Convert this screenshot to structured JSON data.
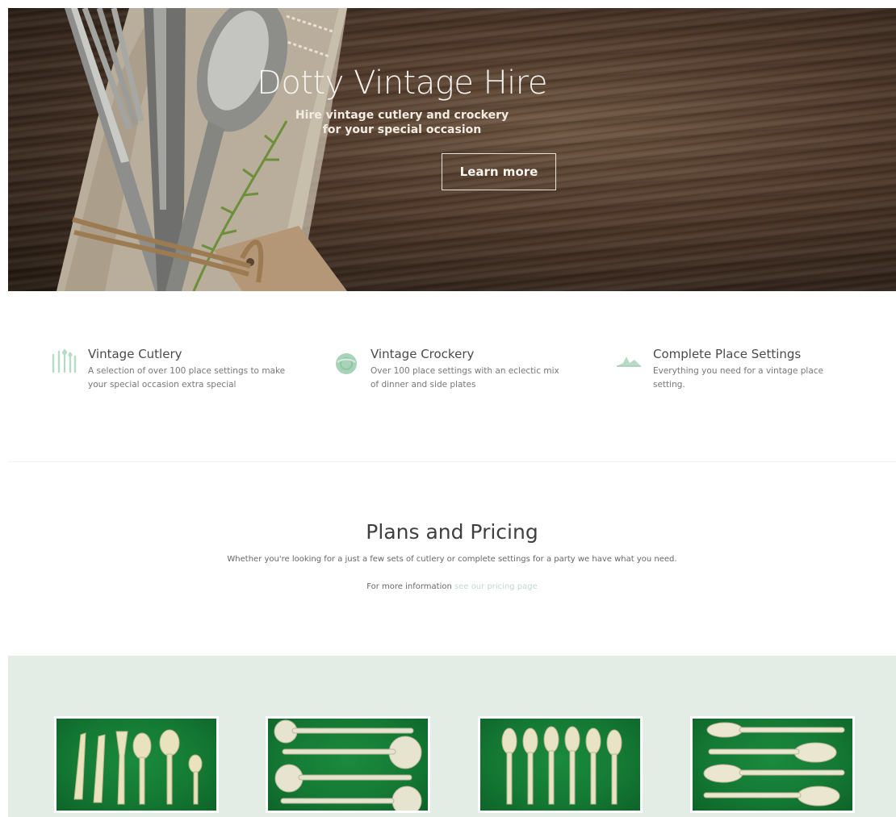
{
  "hero": {
    "title": "Dotty Vintage Hire",
    "subtitle_line1": "Hire vintage cutlery and crockery",
    "subtitle_line2": "for your special occasion",
    "cta_label": "Learn more"
  },
  "features": [
    {
      "icon": "cutlery-icon",
      "title": "Vintage Cutlery",
      "text": "A selection of over 100 place settings to make your special occasion extra special"
    },
    {
      "icon": "plate-icon",
      "title": "Vintage Crockery",
      "text": "Over 100 place settings with an eclectic mix of dinner and side plates"
    },
    {
      "icon": "place-setting-icon",
      "title": "Complete Place Settings",
      "text": "Everything you need for a vintage place setting."
    }
  ],
  "pricing": {
    "title": "Plans and Pricing",
    "description": "Whether you're looking for a just a few sets of cutlery or complete settings for a party we have what you need.",
    "more_prefix": "For more information",
    "more_link": "see our pricing page"
  },
  "colors": {
    "accent": "#a8d3b8",
    "gallery_bg": "#e4ece6",
    "felt_green": "#147a34",
    "link": "#c3dacd"
  }
}
